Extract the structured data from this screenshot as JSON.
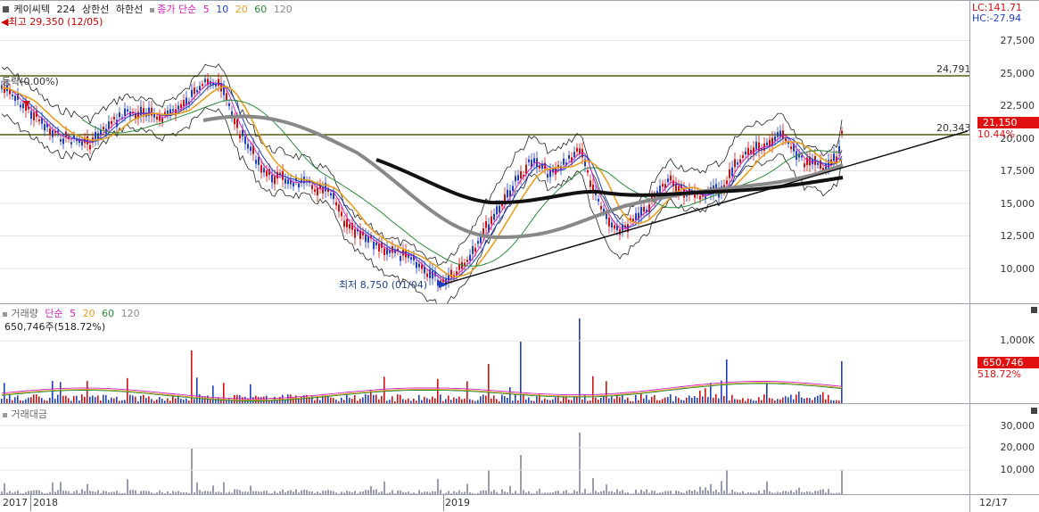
{
  "header": {
    "stock_name": "케이씨텍",
    "code": "224",
    "upper_limit": "상한선",
    "lower_limit": "하한선",
    "ma_label": "종가 단순",
    "ma_periods": [
      "5",
      "10",
      "20",
      "60",
      "120"
    ],
    "max_text": "최고 29,350 (12/05)",
    "min_text": "최저 8,750 (01/04)",
    "lc_text": "LC:141.71",
    "hc_text": "HC:-27.94",
    "ratio_text": "등락(0.00%)"
  },
  "price_axis": {
    "ticks": [
      "27,500",
      "25,000",
      "22,500",
      "20,000",
      "17,500",
      "15,000",
      "12,500",
      "10,000"
    ],
    "current_price": "21,150",
    "current_change": "10.44%",
    "line_upper": "24,791",
    "line_lower": "20,343"
  },
  "volume_pane": {
    "legend_title": "거래량",
    "legend_ma": "단순",
    "ma_periods": [
      "5",
      "20",
      "60",
      "120"
    ],
    "current": "650,746주(518.72%)",
    "ticks": [
      "1,000K"
    ],
    "current_value": "650,746",
    "current_pct": "518.72%"
  },
  "amount_pane": {
    "legend_title": "거래대금",
    "ticks": [
      "30,000",
      "20,000",
      "10,000"
    ]
  },
  "x_axis": {
    "labels": [
      "2017",
      "2018",
      "2019"
    ],
    "right_label": "12/17"
  },
  "colors": {
    "ma5": "#d020c0",
    "ma10": "#1f3fbf",
    "ma20": "#e6a020",
    "ma60": "#2a8a3a",
    "ma120": "#8a8a8a",
    "up": "#d01010",
    "down": "#1f3fbf",
    "tag_red": "#e01010"
  }
}
